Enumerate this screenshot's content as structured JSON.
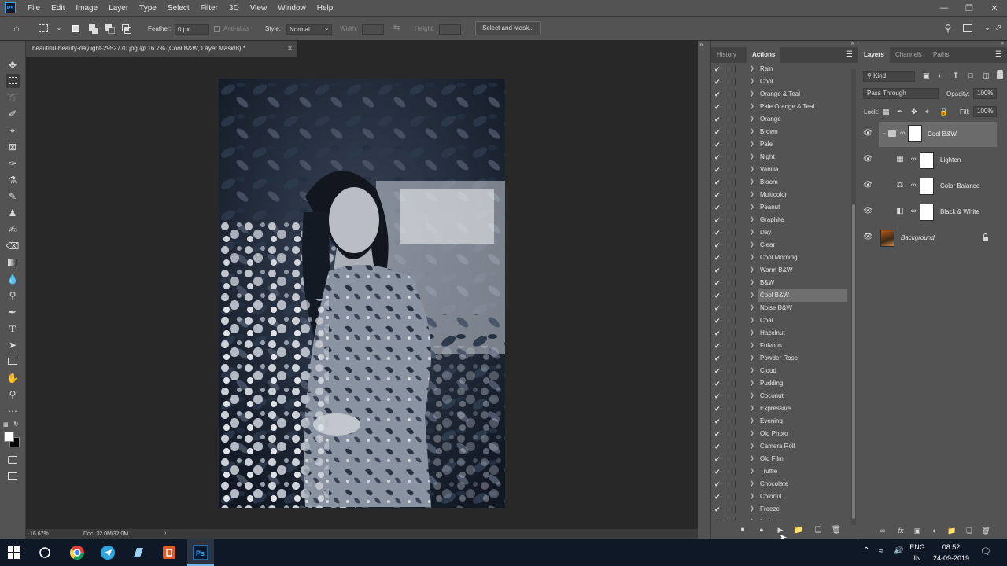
{
  "menubar": {
    "logo": "Ps",
    "items": [
      "File",
      "Edit",
      "Image",
      "Layer",
      "Type",
      "Select",
      "Filter",
      "3D",
      "View",
      "Window",
      "Help"
    ]
  },
  "options": {
    "feather_label": "Feather:",
    "feather_value": "0 px",
    "antialias_label": "Anti-alias",
    "style_label": "Style:",
    "style_value": "Normal",
    "width_label": "Width:",
    "height_label": "Height:",
    "select_mask_label": "Select and Mask..."
  },
  "document": {
    "tab_title": "beautiful-beauty-daylight-2952770.jpg @ 16.7% (Cool B&W, Layer Mask/8) *",
    "zoom": "16.67%",
    "doc_size": "Doc: 32.0M/32.0M"
  },
  "actions_panel": {
    "tabs": [
      "History",
      "Actions"
    ],
    "active_tab": "Actions",
    "selected": "Cool B&W",
    "items": [
      "Rain",
      "Cool",
      "Orange & Teal",
      "Pale Orange & Teal",
      "Orange",
      "Brown",
      "Pale",
      "Night",
      "Vanilla",
      "Bloom",
      "Multicolor",
      "Peanut",
      "Graphite",
      "Day",
      "Clear",
      "Cool Morning",
      "Warm B&W",
      "B&W",
      "Cool B&W",
      "Noise B&W",
      "Coal",
      "Hazelnut",
      "Fulvous",
      "Powder Rose",
      "Cloud",
      "Pudding",
      "Coconut",
      "Expressive",
      "Evening",
      "Old Photo",
      "Camera Roll",
      "Old Film",
      "Truffle",
      "Chocolate",
      "Colorful",
      "Freeze",
      "Iceberg"
    ]
  },
  "layers_panel": {
    "tabs": [
      "Layers",
      "Channels",
      "Paths"
    ],
    "active_tab": "Layers",
    "filter_kind": "Kind",
    "blend_mode": "Pass Through",
    "opacity_label": "Opacity:",
    "opacity_value": "100%",
    "lock_label": "Lock:",
    "fill_label": "Fill:",
    "fill_value": "100%",
    "layers": [
      {
        "name": "Cool B&W",
        "type": "group",
        "selected": true
      },
      {
        "name": "Lighten",
        "type": "adjustment",
        "icon": "levels-icon"
      },
      {
        "name": "Color Balance",
        "type": "adjustment",
        "icon": "color-balance-icon"
      },
      {
        "name": "Black & White",
        "type": "adjustment",
        "icon": "black-white-icon"
      },
      {
        "name": "Background",
        "type": "image",
        "locked": true
      }
    ]
  },
  "taskbar": {
    "lang_top": "ENG",
    "lang_bottom": "IN",
    "time": "08:52",
    "date": "24-09-2019"
  },
  "colors": {
    "panel_bg": "#535353",
    "canvas_bg": "#282828",
    "accent": "#31a8ff",
    "taskbar_bg": "#0f1826"
  }
}
